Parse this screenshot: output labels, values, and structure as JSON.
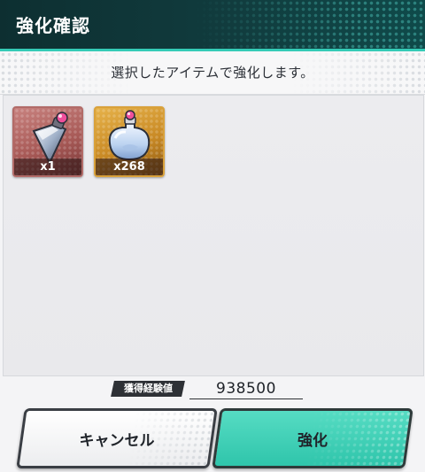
{
  "dialog": {
    "title": "強化確認",
    "message": "選択したアイテムで強化します。"
  },
  "items": [
    {
      "name": "crystal-item",
      "icon": "crystal-vial-icon",
      "count": "x1",
      "frame_color": "#b26b68"
    },
    {
      "name": "potion-item",
      "icon": "potion-flask-icon",
      "count": "x268",
      "frame_color": "#d9a13a"
    }
  ],
  "experience": {
    "label": "獲得経験値",
    "value": "938500"
  },
  "buttons": {
    "cancel_label": "キャンセル",
    "confirm_label": "強化"
  },
  "colors": {
    "header_bg": "#113c3e",
    "accent": "#35cbb6",
    "confirm_button": "#3fd0b6"
  }
}
